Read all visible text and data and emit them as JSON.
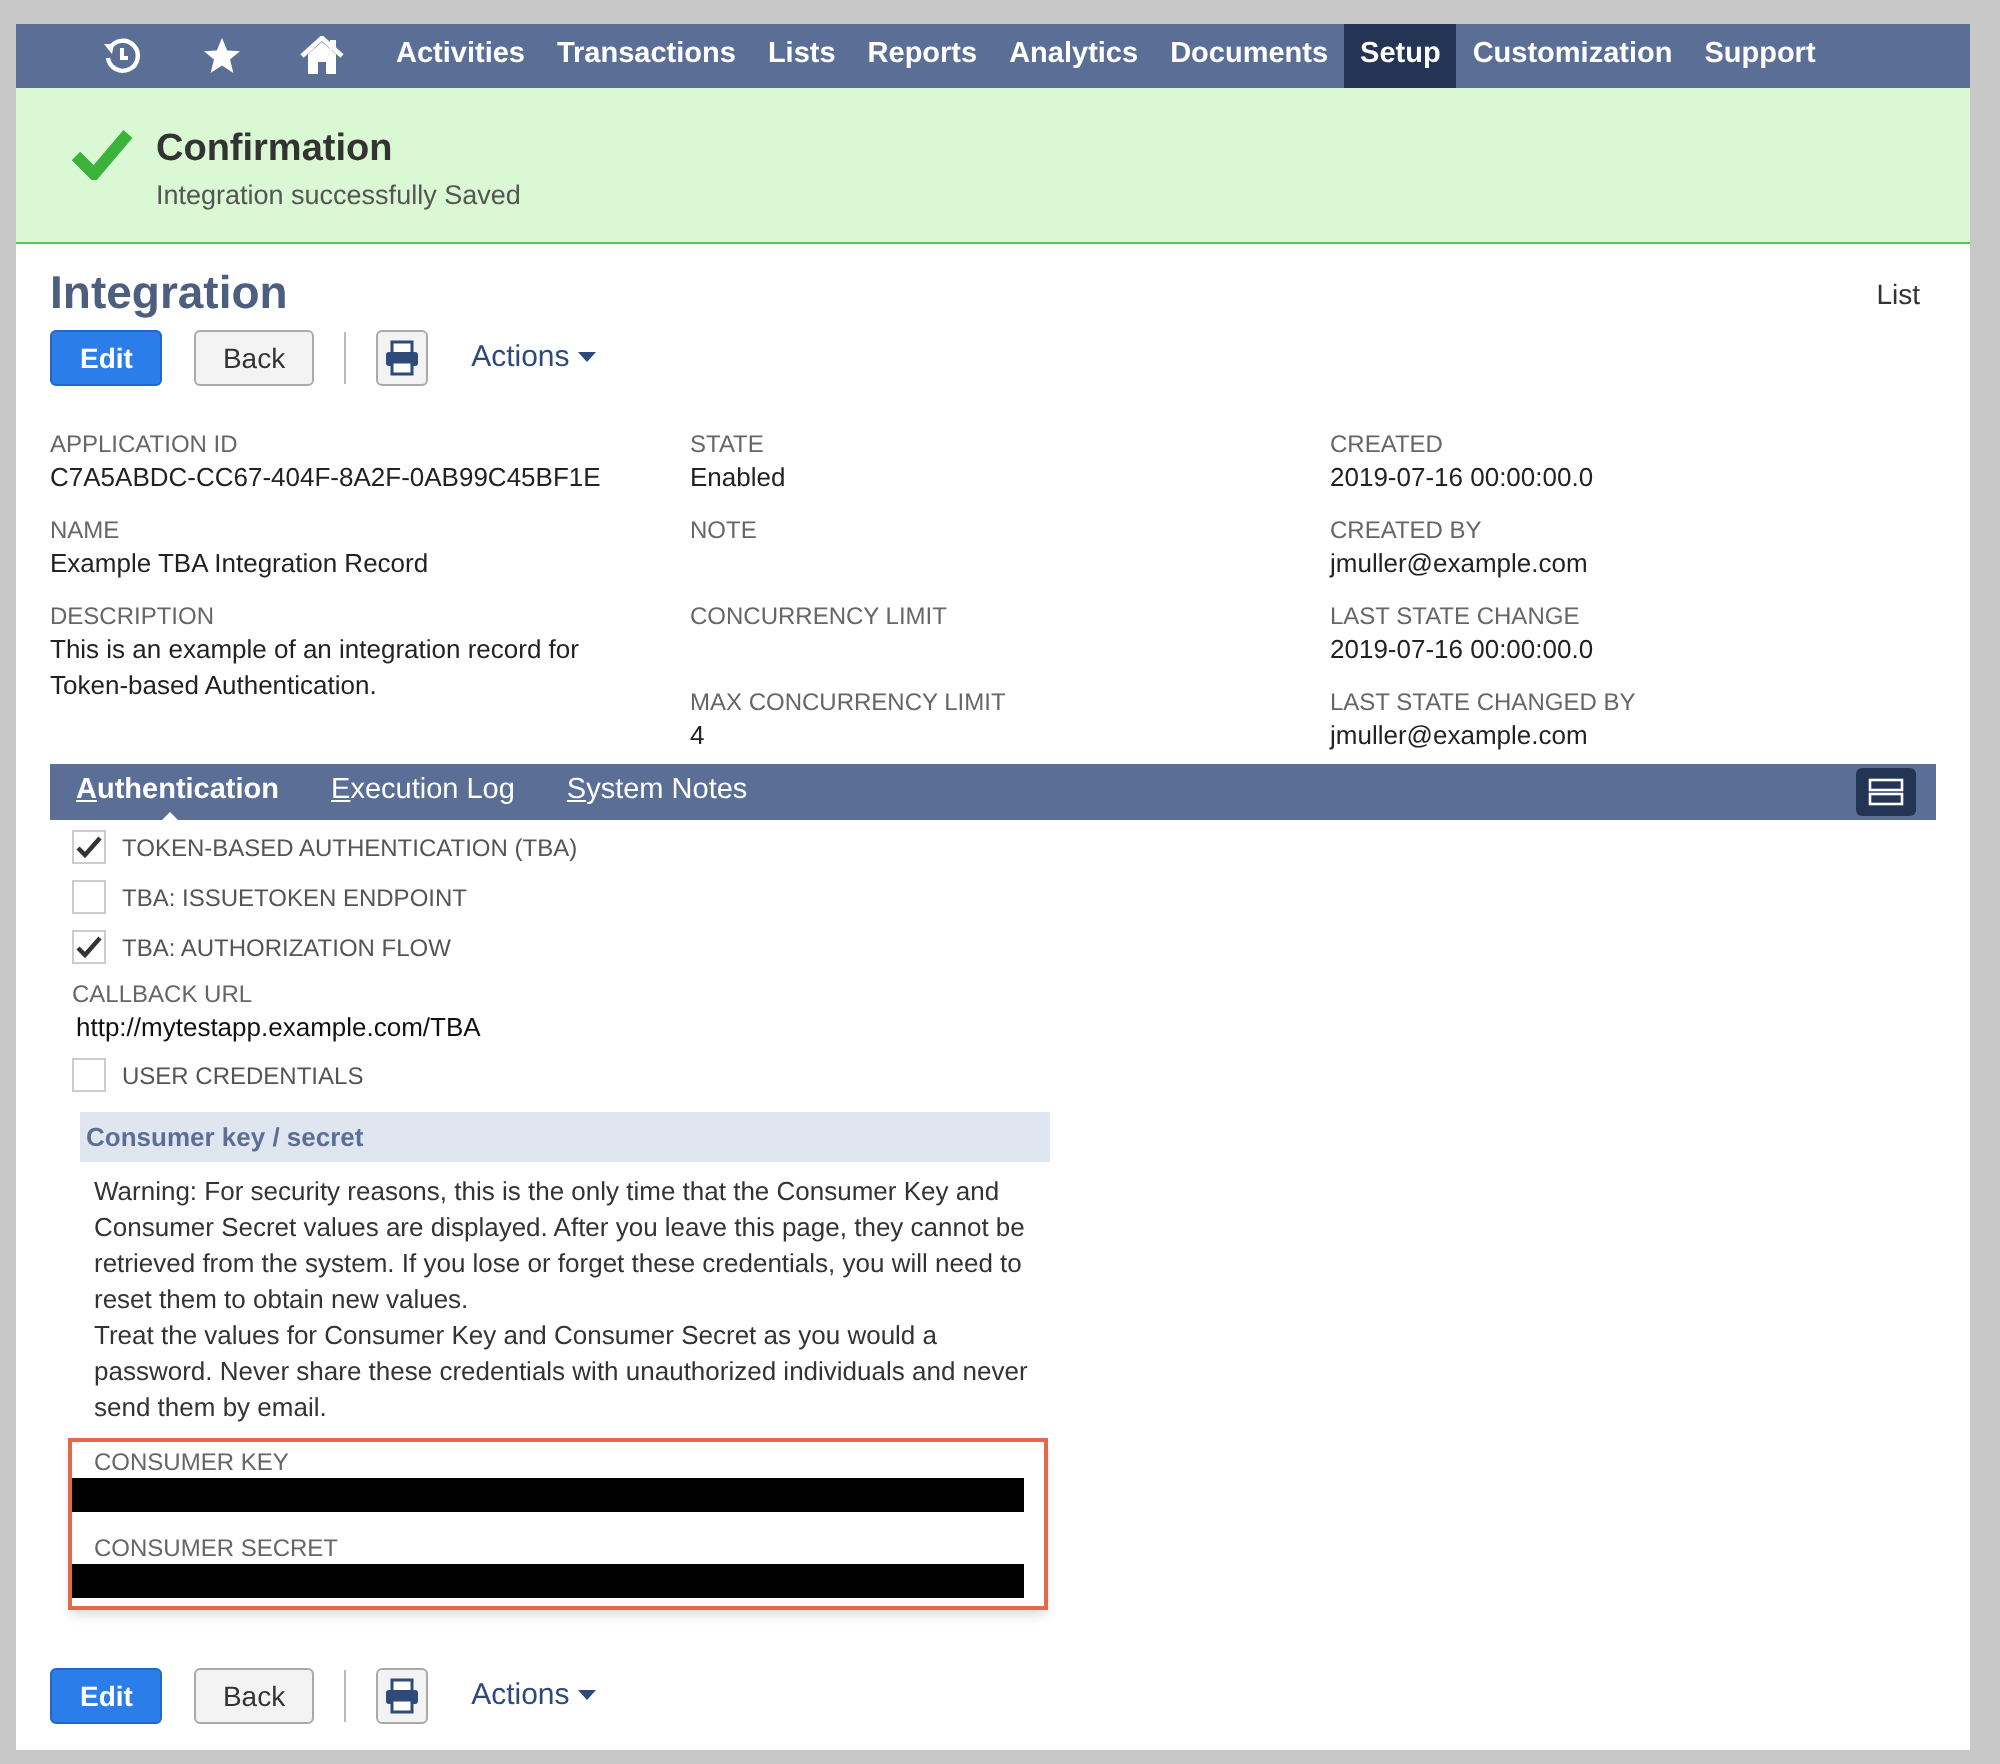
{
  "nav": [
    {
      "kind": "history",
      "selected": false
    },
    {
      "kind": "star",
      "selected": false
    },
    {
      "kind": "home",
      "selected": false
    },
    {
      "kind": "text",
      "label": "Activities",
      "selected": false
    },
    {
      "kind": "text",
      "label": "Transactions",
      "selected": false
    },
    {
      "kind": "text",
      "label": "Lists",
      "selected": false
    },
    {
      "kind": "text",
      "label": "Reports",
      "selected": false
    },
    {
      "kind": "text",
      "label": "Analytics",
      "selected": false
    },
    {
      "kind": "text",
      "label": "Documents",
      "selected": false
    },
    {
      "kind": "text",
      "label": "Setup",
      "selected": true
    },
    {
      "kind": "text",
      "label": "Customization",
      "selected": false
    },
    {
      "kind": "text",
      "label": "Support",
      "selected": false
    }
  ],
  "confirmation": {
    "title": "Confirmation",
    "message": "Integration successfully Saved"
  },
  "page": {
    "title": "Integration",
    "list_link": "List"
  },
  "toolbar": {
    "edit": "Edit",
    "back": "Back",
    "actions": "Actions"
  },
  "fields": [
    [
      {
        "label": "APPLICATION ID",
        "value": "C7A5ABDC-CC67-404F-8A2F-0AB99C45BF1E"
      },
      {
        "label": "NAME",
        "value": "Example TBA Integration Record"
      },
      {
        "label": "DESCRIPTION",
        "value": "This is an example of an integration record for Token-based Authentication."
      }
    ],
    [
      {
        "label": "STATE",
        "value": "Enabled"
      },
      {
        "label": "NOTE"
      },
      {
        "label": "CONCURRENCY LIMIT"
      },
      {
        "label": "MAX CONCURRENCY LIMIT",
        "value": "4"
      }
    ],
    [
      {
        "label": "CREATED",
        "value": "2019-07-16 00:00:00.0"
      },
      {
        "label": "CREATED BY",
        "value": "jmuller@example.com"
      },
      {
        "label": "LAST STATE CHANGE",
        "value": "2019-07-16 00:00:00.0"
      },
      {
        "label": "LAST STATE CHANGED BY",
        "value": "jmuller@example.com"
      }
    ]
  ],
  "subtabs": [
    {
      "label": "Authentication",
      "selected": true
    },
    {
      "label": "Execution Log",
      "selected": false
    },
    {
      "label": "System Notes",
      "selected": false
    }
  ],
  "auth_items": [
    {
      "kind": "checkbox",
      "label": "TOKEN-BASED AUTHENTICATION (TBA)",
      "checked": true
    },
    {
      "kind": "checkbox",
      "label": "TBA: ISSUETOKEN ENDPOINT",
      "checked": false
    },
    {
      "kind": "checkbox",
      "label": "TBA: AUTHORIZATION FLOW",
      "checked": true
    },
    {
      "kind": "field",
      "label": "CALLBACK URL",
      "value": "http://mytestapp.example.com/TBA"
    },
    {
      "kind": "checkbox",
      "label": "USER CREDENTIALS",
      "checked": false
    }
  ],
  "consumer": {
    "heading": "Consumer key / secret",
    "warning": [
      "Warning: For security reasons, this is the only time that the Consumer Key and Consumer Secret values are displayed. After you leave this page, they cannot be retrieved from the system. If you lose or forget these credentials, you will need to reset them to obtain new values.",
      "Treat the values for Consumer Key and Consumer Secret as you would a password. Never share these credentials with unauthorized individuals and never send them by email."
    ],
    "secrets": [
      {
        "label": "CONSUMER KEY"
      },
      {
        "label": "CONSUMER SECRET"
      }
    ]
  },
  "bottom_toolbar": {
    "edit": "Edit",
    "back": "Back",
    "actions": "Actions"
  }
}
